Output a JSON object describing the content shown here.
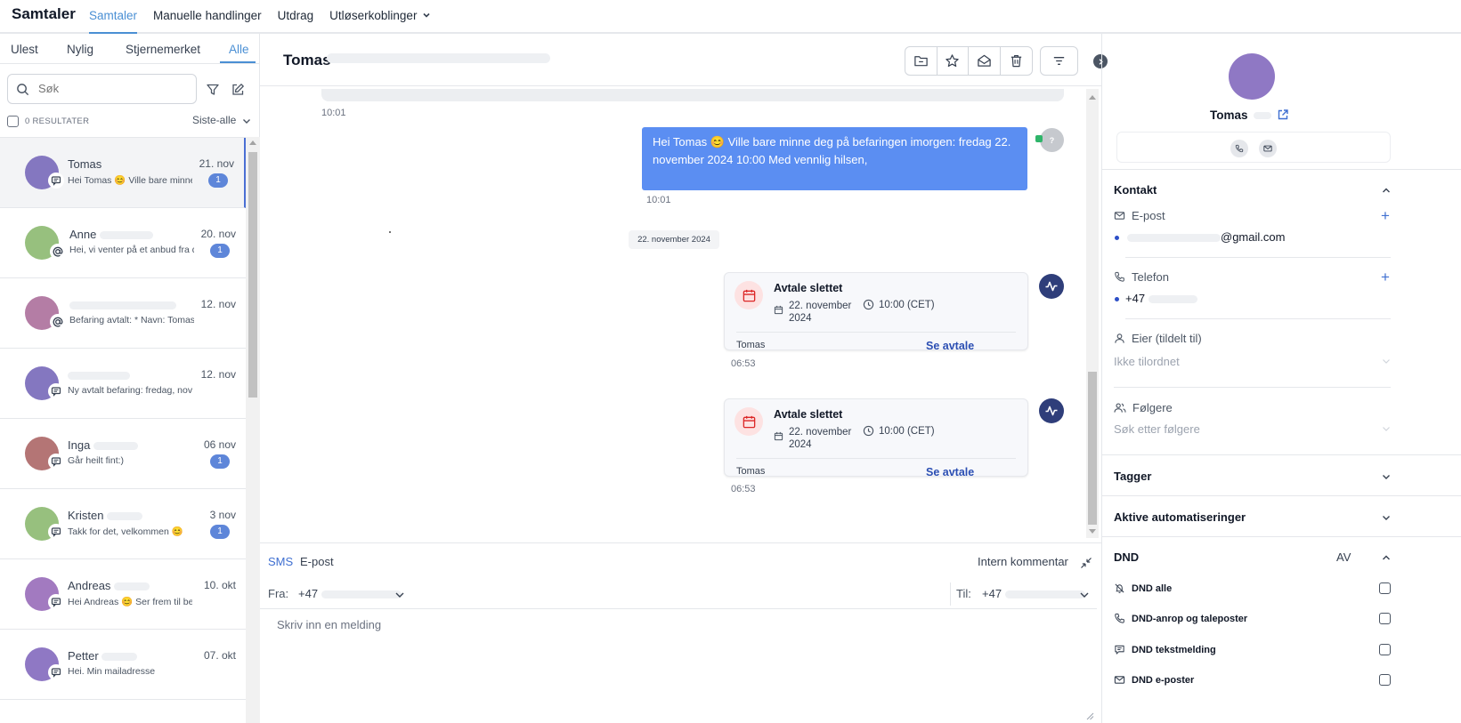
{
  "brand": "Samtaler",
  "top_nav": [
    {
      "label": "Samtaler",
      "active": true
    },
    {
      "label": "Manuelle handlinger",
      "active": false
    },
    {
      "label": "Utdrag",
      "active": false
    },
    {
      "label": "Utløserkoblinger",
      "active": false
    }
  ],
  "left_tabs": [
    {
      "label": "Ulest",
      "active": false
    },
    {
      "label": "Nylig",
      "active": false
    },
    {
      "label": "Stjernemerket",
      "active": false
    },
    {
      "label": "Alle",
      "active": true
    }
  ],
  "search": {
    "placeholder": "Søk"
  },
  "results_label": "0 RESULTATER",
  "sort_label": "Siste-alle",
  "conversations": [
    {
      "name": "Tomas",
      "date": "21. nov",
      "preview": "Hei Tomas 😊 Ville bare minne deg",
      "badge": "1",
      "channel": "sms",
      "avatar_color": "#8477c0",
      "selected": true
    },
    {
      "name": "Anne",
      "date": "20. nov",
      "preview": "Hei, vi venter på et anbud fra deg",
      "badge": "1",
      "channel": "email",
      "avatar_color": "#97c07e",
      "selected": false
    },
    {
      "name": "",
      "date": "12. nov",
      "preview": "Befaring avtalt: * Navn: Tomas",
      "badge": "",
      "channel": "email",
      "avatar_color": "#b47da5",
      "selected": false
    },
    {
      "name": "",
      "date": "12. nov",
      "preview": "Ny avtalt befaring: fredag, november",
      "badge": "",
      "channel": "sms",
      "avatar_color": "#8477c0",
      "selected": false
    },
    {
      "name": "Inga",
      "date": "06 nov",
      "preview": "Går heilt fint:)",
      "badge": "1",
      "channel": "sms",
      "avatar_color": "#b47575",
      "selected": false
    },
    {
      "name": "Kristen",
      "date": "3 nov",
      "preview": "Takk for det, velkommen 😊",
      "badge": "1",
      "channel": "sms",
      "avatar_color": "#97c07e",
      "selected": false
    },
    {
      "name": "Andreas",
      "date": "10. okt",
      "preview": "Hei Andreas 😊 Ser frem til befaring",
      "badge": "",
      "channel": "sms",
      "avatar_color": "#a27ac0",
      "selected": false
    },
    {
      "name": "Petter",
      "date": "07. okt",
      "preview": "Hei. Min mailadresse",
      "badge": "",
      "channel": "sms",
      "avatar_color": "#8f78c4",
      "selected": false
    }
  ],
  "chat": {
    "title": "Tomas",
    "earlier_time": "10:01",
    "outgoing_message": "Hei Tomas 😊 Ville bare minne deg på befaringen imorgen: fredag 22. november 2024 10:00 Med vennlig hilsen,",
    "outgoing_time": "10:01",
    "sender_avatar": "?",
    "date_divider": "22. november 2024",
    "events": [
      {
        "title": "Avtale slettet",
        "date": "22. november 2024",
        "time": "10:00 (CET)",
        "contact": "Tomas",
        "link": "Se avtale",
        "timestamp": "06:53"
      },
      {
        "title": "Avtale slettet",
        "date": "22. november 2024",
        "time": "10:00 (CET)",
        "contact": "Tomas",
        "link": "Se avtale",
        "timestamp": "06:53"
      }
    ]
  },
  "composer": {
    "tabs": [
      "SMS",
      "E-post"
    ],
    "internal_comment": "Intern kommentar",
    "from_label": "Fra:",
    "from_value": "+47",
    "to_label": "Til:",
    "to_value": "+47",
    "placeholder": "Skriv inn en melding"
  },
  "contact": {
    "name": "Tomas",
    "sections": {
      "kontakt": "Kontakt",
      "email_label": "E-post",
      "email_value": "@gmail.com",
      "phone_label": "Telefon",
      "phone_value": "+47",
      "owner_label": "Eier (tildelt til)",
      "owner_value": "Ikke tilordnet",
      "followers_label": "Følgere",
      "followers_placeholder": "Søk etter følgere",
      "tags": "Tagger",
      "automations": "Aktive automatiseringer",
      "dnd": "DND",
      "dnd_status": "AV"
    },
    "dnd_options": [
      "DND alle",
      "DND-anrop og taleposter",
      "DND tekstmelding",
      "DND e-poster"
    ]
  },
  "colors": {
    "accent": "#4a8fd4",
    "bubble": "#5b8ef2",
    "badge": "#5e86d9",
    "link": "#2c4fb3"
  }
}
